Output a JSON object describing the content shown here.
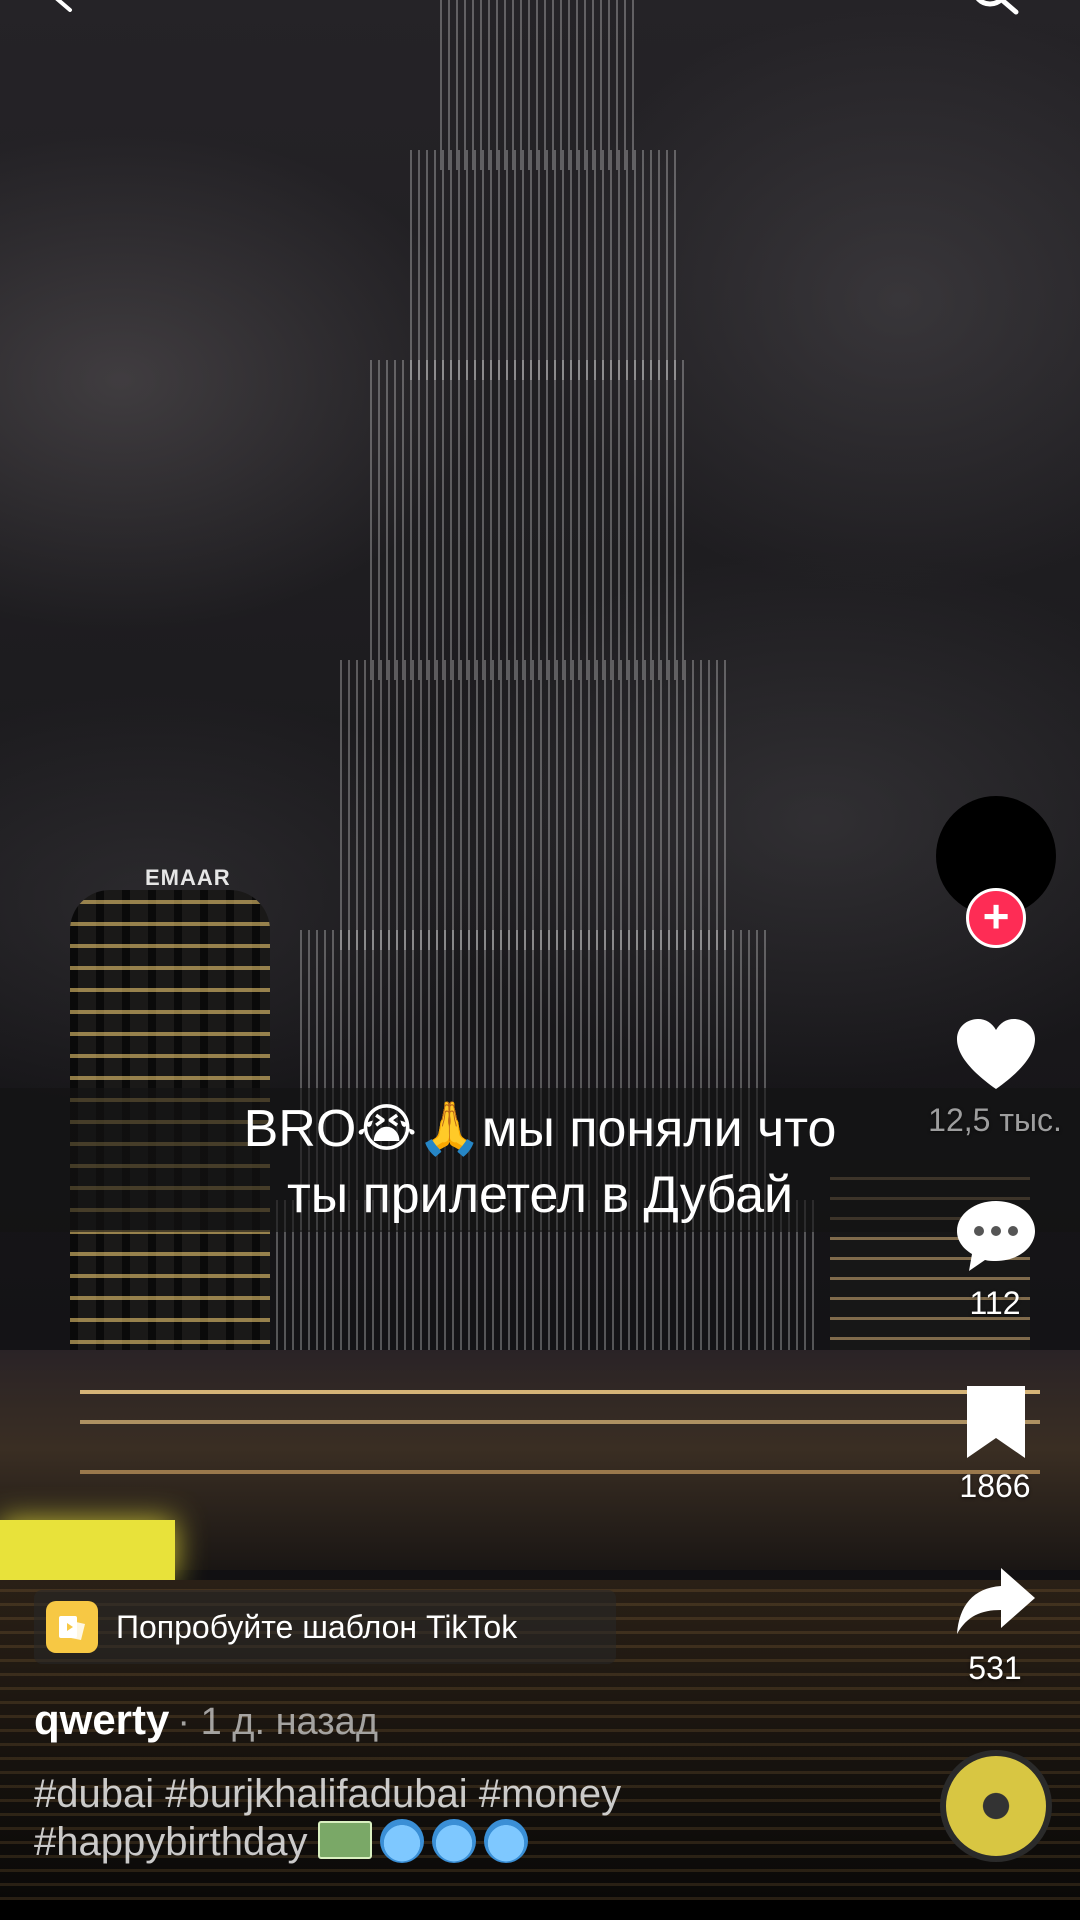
{
  "caption": {
    "line1": "BRO😭🙏мы поняли что",
    "line2": "ты прилетел в Дубай"
  },
  "scene": {
    "sign_text": "EMAAR"
  },
  "actions": {
    "likes": "12,5 тыс.",
    "comments": "112",
    "saves": "1866",
    "shares": "531",
    "follow_symbol": "+"
  },
  "template": {
    "label": "Попробуйте шаблон TikTok"
  },
  "post": {
    "author": "qwerty",
    "meta": "· 1 д. назад",
    "description_line1": "#dubai #burjkhalifadubai #money",
    "description_line2": "#happybirthday"
  },
  "colors": {
    "follow": "#fe2c55",
    "template_icon": "#f7c844"
  },
  "icons": [
    "back-arrow-icon",
    "search-icon",
    "heart-icon",
    "comment-icon",
    "bookmark-icon",
    "share-icon",
    "template-icon",
    "music-disc-icon"
  ]
}
